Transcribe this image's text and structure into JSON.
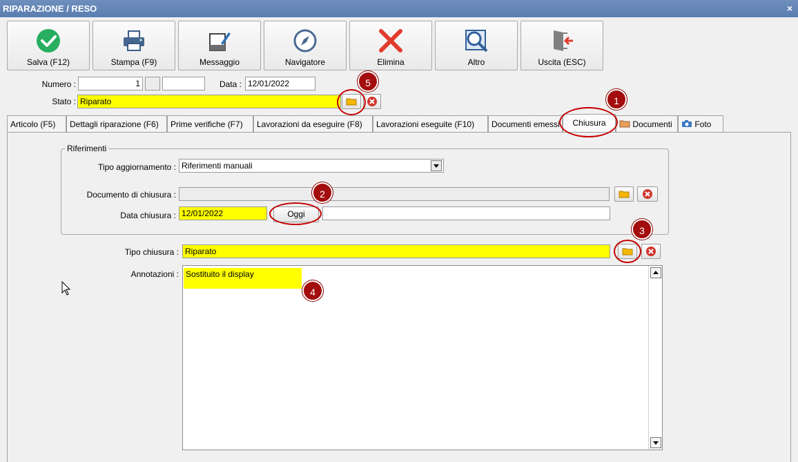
{
  "window": {
    "title": "RIPARAZIONE / RESO",
    "close_glyph": "×"
  },
  "toolbar": [
    {
      "label": "Salva (F12)",
      "icon": "check-circle-icon"
    },
    {
      "label": "Stampa (F9)",
      "icon": "printer-icon"
    },
    {
      "label": "Messaggio",
      "icon": "message-edit-icon"
    },
    {
      "label": "Navigatore",
      "icon": "compass-icon"
    },
    {
      "label": "Elimina",
      "icon": "delete-x-icon"
    },
    {
      "label": "Altro",
      "icon": "magnifier-icon"
    },
    {
      "label": "Uscita (ESC)",
      "icon": "exit-door-icon"
    }
  ],
  "header": {
    "numero_label": "Numero :",
    "numero_value": "1",
    "numero_suffix": "",
    "data_label": "Data :",
    "data_value": "12/01/2022",
    "stato_label": "Stato :",
    "stato_value": "Riparato"
  },
  "tabs": [
    {
      "label": "Articolo (F5)"
    },
    {
      "label": "Dettagli riparazione (F6)"
    },
    {
      "label": "Prime verifiche (F7)"
    },
    {
      "label": "Lavorazioni da eseguire (F8)"
    },
    {
      "label": "Lavorazioni eseguite  (F10)"
    },
    {
      "label": "Documenti emessi"
    },
    {
      "label": "Chiusura",
      "active": true
    },
    {
      "label": "Documenti",
      "icon": "folder-icon"
    },
    {
      "label": "Foto",
      "icon": "camera-icon"
    }
  ],
  "riferimenti": {
    "group_title": "Riferimenti",
    "tipo_aggiornamento_label": "Tipo aggiornamento :",
    "tipo_aggiornamento_value": "Riferimenti manuali",
    "documento_chiusura_label": "Documento di chiusura :",
    "documento_chiusura_value": "",
    "data_chiusura_label": "Data chiusura :",
    "data_chiusura_value": "12/01/2022",
    "oggi_button": "Oggi",
    "data_chiusura_extra": ""
  },
  "chiusura": {
    "tipo_chiusura_label": "Tipo chiusura :",
    "tipo_chiusura_value": "Riparato",
    "annotazioni_label": "Annotazioni :",
    "annotazioni_value": "Sostituito il display"
  },
  "markers": [
    "1",
    "2",
    "3",
    "4",
    "5"
  ],
  "colors": {
    "highlight": "#ffff00",
    "marker": "#a30d0d",
    "title_bar": "#5a7db0",
    "delete": "#d0342c"
  }
}
